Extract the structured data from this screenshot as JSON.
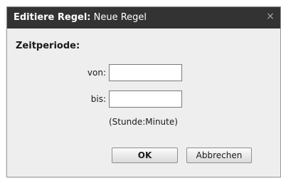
{
  "dialog": {
    "title_bold": "Editiere Regel:",
    "title_normal": " Neue Regel",
    "close_glyph": "×"
  },
  "form": {
    "section_title": "Zeitperiode:",
    "from_label": "von:",
    "from_value": "",
    "to_label": "bis:",
    "to_value": "",
    "hint": "(Stunde:Minute)"
  },
  "buttons": {
    "ok_label": "OK",
    "cancel_label": "Abbrechen"
  }
}
